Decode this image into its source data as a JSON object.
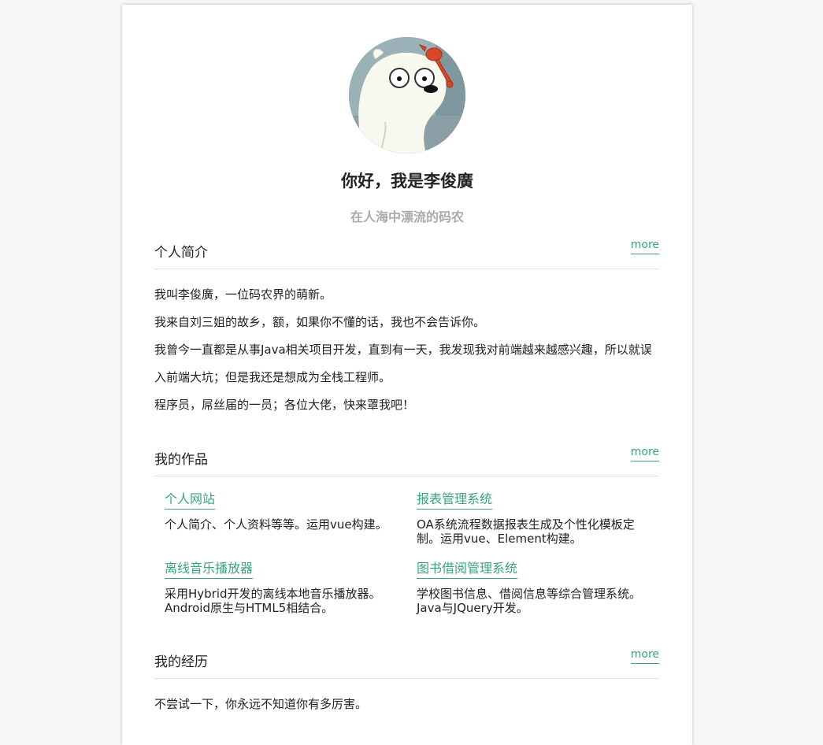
{
  "profile": {
    "title": "你好，我是李俊廣",
    "subtitle": "在人海中漂流的码农"
  },
  "sections": {
    "intro": {
      "heading": "个人简介",
      "more": "more",
      "paragraphs": [
        "我叫李俊廣，一位码农界的萌新。",
        "我来自刘三姐的故乡，额，如果你不懂的话，我也不会告诉你。",
        "我曾今一直都是从事Java相关项目开发，直到有一天，我发现我对前端越来越感兴趣，所以就误入前端大坑；但是我还是想成为全栈工程师。",
        "程序员，屌丝届的一员；各位大佬，快来罩我吧！"
      ]
    },
    "works": {
      "heading": "我的作品",
      "more": "more",
      "items": [
        {
          "title": "个人网站",
          "desc": "个人简介、个人资料等等。运用vue构建。"
        },
        {
          "title": "报表管理系统",
          "desc": "OA系统流程数据报表生成及个性化模板定制。运用vue、Element构建。"
        },
        {
          "title": "离线音乐播放器",
          "desc": "采用Hybrid开发的离线本地音乐播放器。Android原生与HTML5相结合。"
        },
        {
          "title": "图书借阅管理系统",
          "desc": "学校图书信息、借阅信息等综合管理系统。Java与JQuery开发。"
        }
      ]
    },
    "experience": {
      "heading": "我的经历",
      "more": "more",
      "paragraphs": [
        "不尝试一下，你永远不知道你有多厉害。"
      ]
    }
  },
  "colors": {
    "accent": "#3aa37e",
    "muted": "#aaaaaa",
    "text": "#222222"
  }
}
